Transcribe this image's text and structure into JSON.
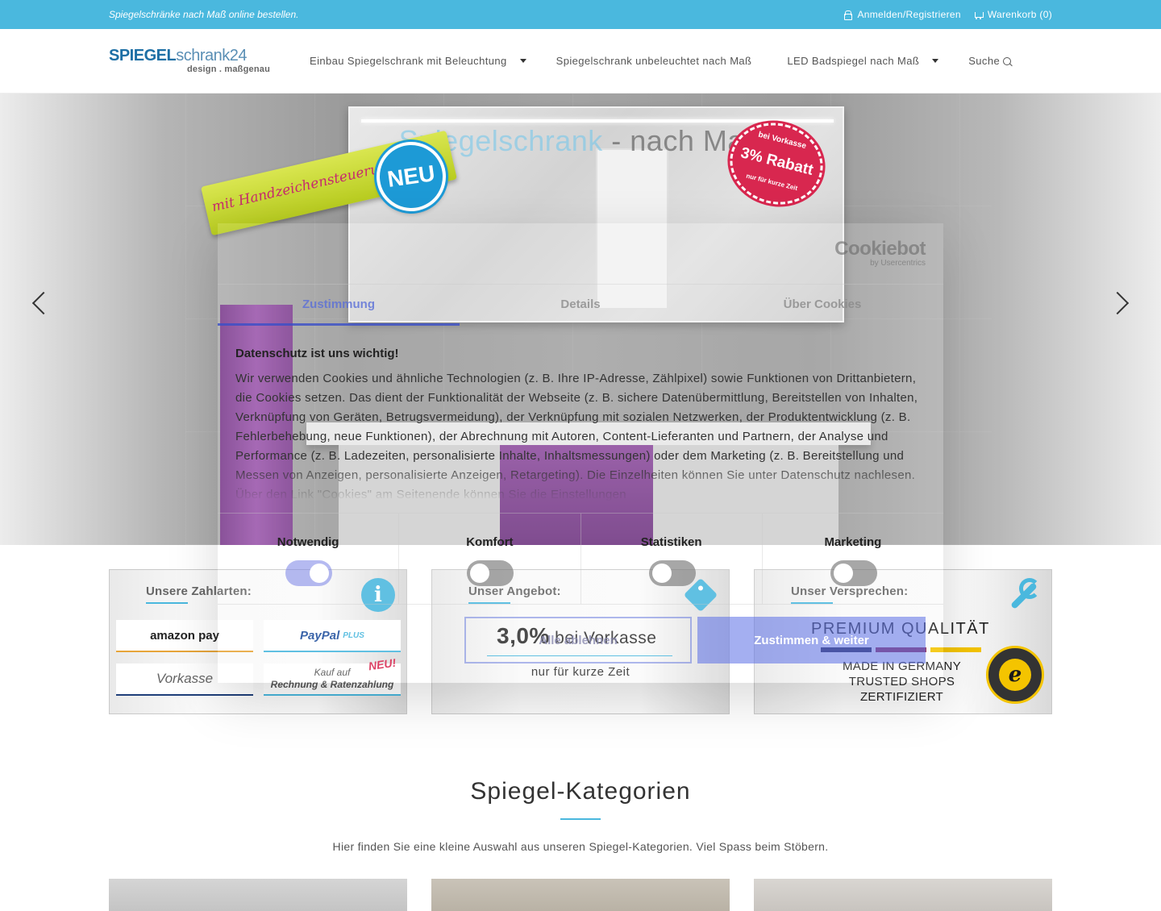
{
  "topbar": {
    "tagline": "Spiegelschränke nach Maß online bestellen.",
    "login": "Anmelden/Registrieren",
    "cart": "Warenkorb (0)"
  },
  "header": {
    "logo_main": "SPIEGEL",
    "logo_rest": "schrank24",
    "logo_tagline": "design . maßgenau",
    "nav": [
      {
        "label": "Einbau Spiegelschrank mit Beleuchtung",
        "has_dropdown": true
      },
      {
        "label": "Spiegelschrank unbeleuchtet nach Maß",
        "has_dropdown": false
      },
      {
        "label": "LED Badspiegel nach Maß",
        "has_dropdown": true
      },
      {
        "label": "Suche",
        "has_dropdown": false
      }
    ]
  },
  "hero": {
    "title_blue": "Spiegelschrank",
    "title_dark": " - nach Maß",
    "badge_band": "mit Handzeichensteuerung",
    "badge_neu": "NEU",
    "badge_rabatt_top": "bei Vorkasse",
    "badge_rabatt_main": "3% Rabatt",
    "badge_rabatt_bottom": "nur für kurze Zeit"
  },
  "boxes": {
    "payment": {
      "title": "Unsere Zahlarten:",
      "amazon": "amazon pay",
      "paypal": "PayPal",
      "paypal_suffix": "PLUS",
      "vorkasse": "Vorkasse",
      "rechnung_line1": "Kauf auf",
      "rechnung_line2": "Rechnung & Ratenzahlung",
      "rechnung_badge": "NEU!"
    },
    "offer": {
      "title": "Unser Angebot:",
      "percent": "3,0%",
      "text": " bei Vorkasse",
      "sub": "nur für kurze Zeit"
    },
    "promise": {
      "title": "Unser Versprechen:",
      "headline": "PREMIUM QUALITÄT",
      "line1": "MADE IN GERMANY",
      "line2": "TRUSTED SHOPS",
      "line3": "ZERTIFIZIERT",
      "seal_letter": "e",
      "flag_colors": [
        "#1a1a40",
        "#8b1e4a",
        "#f4c400"
      ]
    }
  },
  "categories": {
    "title": "Spiegel-Kategorien",
    "subtitle": "Hier finden Sie eine kleine Auswahl aus unseren Spiegel-Kategorien. Viel Spass beim Stöbern."
  },
  "cookie": {
    "brand": "Cookiebot",
    "brand_sub": "by Usercentrics",
    "tabs": [
      "Zustimmung",
      "Details",
      "Über Cookies"
    ],
    "heading": "Datenschutz ist uns wichtig!",
    "text": "Wir verwenden Cookies und ähnliche Technologien (z. B. Ihre IP-Adresse, Zählpixel) sowie Funktionen von Drittanbietern, die Cookies setzen. Das dient der Funktionalität der Webseite (z. B. sichere Datenübermittlung, Bereitstellen von Inhalten, Verknüpfung von Geräten, Betrugsvermeidung), der Verknüpfung mit sozialen Netzwerken, der Produktentwicklung (z. B. Fehlerbehebung, neue Funktionen), der Abrechnung mit Autoren, Content-Lieferanten und Partnern, der Analyse und Performance (z. B. Ladezeiten, personalisierte Inhalte, Inhaltsmessungen) oder dem Marketing (z. B. Bereitstellung und Messen von Anzeigen, personalisierte Anzeigen, Retargeting). Die Einzelheiten können Sie unter Datenschutz nachlesen. Über den Link \"Cookies\" am Seitenende können Sie die Einstellungen",
    "categories": [
      {
        "label": "Notwendig",
        "enabled": true
      },
      {
        "label": "Komfort",
        "enabled": false
      },
      {
        "label": "Statistiken",
        "enabled": false
      },
      {
        "label": "Marketing",
        "enabled": false
      }
    ],
    "btn_select": "Alle ablehnen",
    "btn_accept": "Zustimmen & weiter"
  },
  "colors": {
    "accent": "#4ab8de",
    "cookie_accent": "#3a4fc8"
  }
}
